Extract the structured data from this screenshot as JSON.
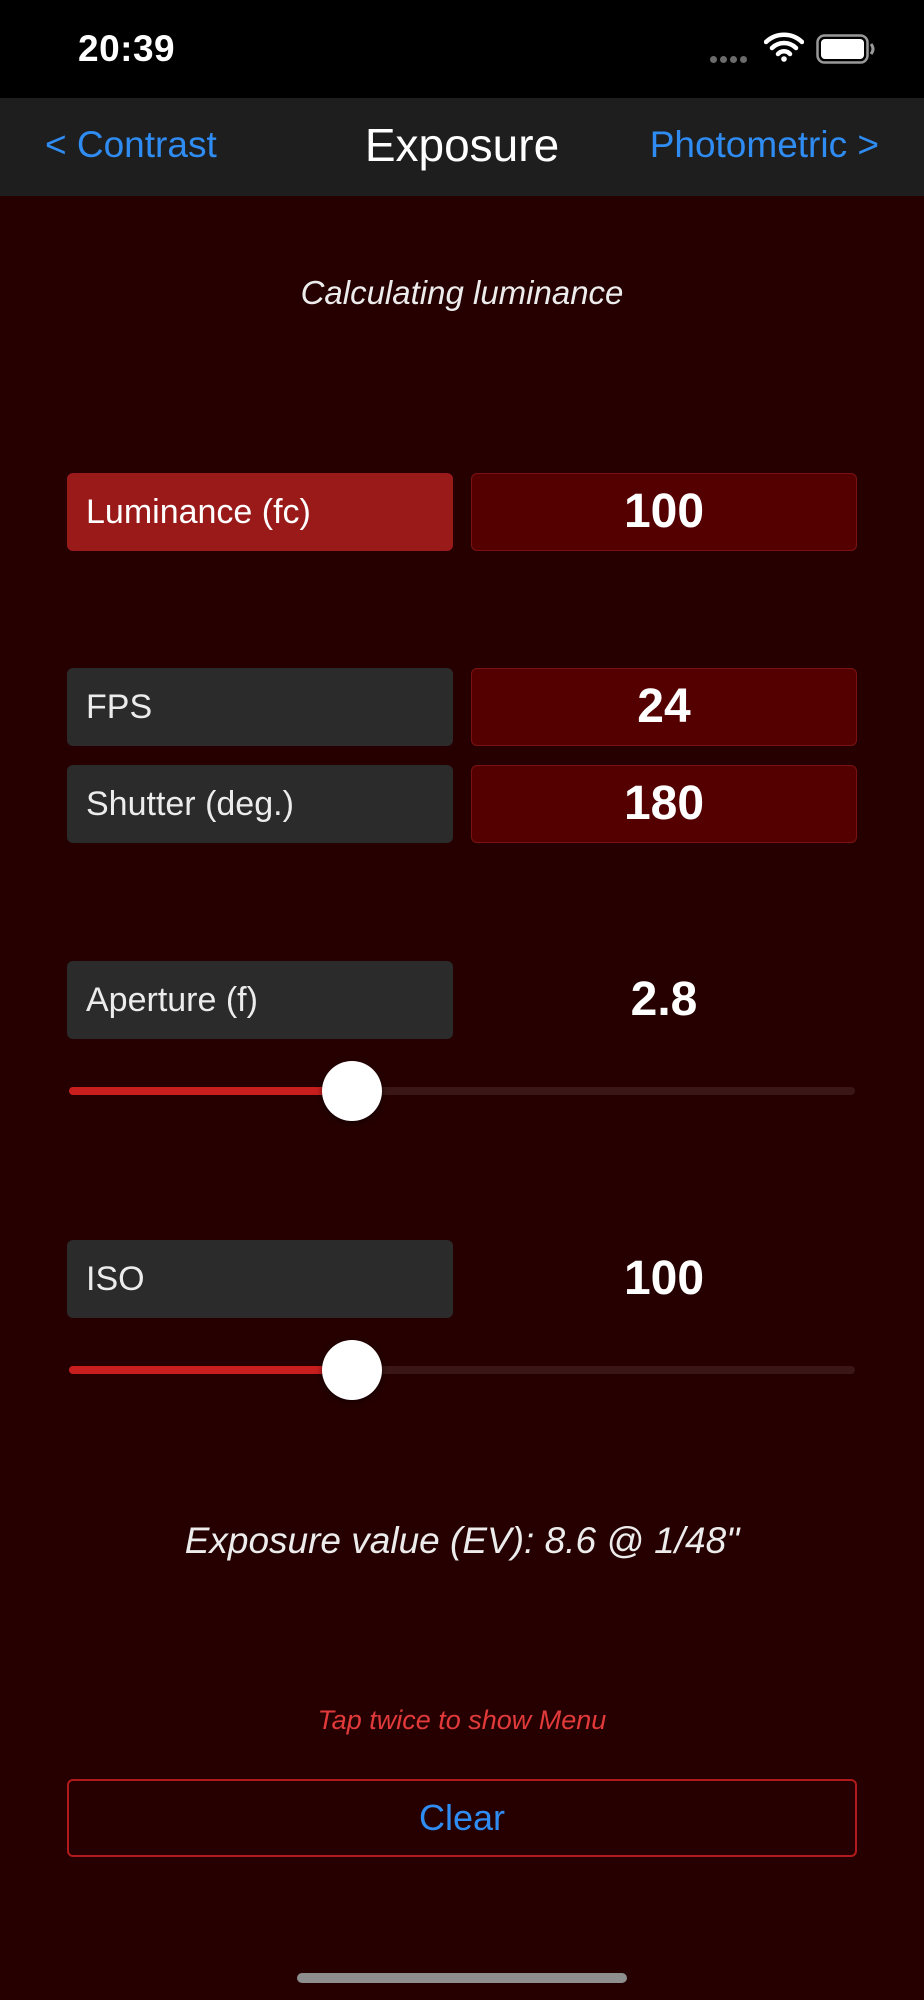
{
  "status_bar": {
    "time": "20:39",
    "icons": [
      "cellular-signal-icon",
      "wifi-icon",
      "battery-icon"
    ]
  },
  "nav": {
    "back_label": "< Contrast",
    "title": "Exposure",
    "forward_label": "Photometric >"
  },
  "subtitle": "Calculating luminance",
  "fields": {
    "luminance": {
      "label": "Luminance (fc)",
      "value": "100"
    },
    "fps": {
      "label": "FPS",
      "value": "24"
    },
    "shutter": {
      "label": "Shutter (deg.)",
      "value": "180"
    },
    "aperture": {
      "label": "Aperture (f)",
      "value": "2.8",
      "slider_fraction": 0.36
    },
    "iso": {
      "label": "ISO",
      "value": "100",
      "slider_fraction": 0.36
    }
  },
  "exposure_value_text": "Exposure value (EV): 8.6 @ 1/48\"",
  "hint": "Tap twice to show Menu",
  "clear_label": "Clear",
  "colors": {
    "background": "#260000",
    "accent_red": "#c81e1e",
    "link_blue": "#2f8cf2",
    "active_label": "#9a1a1a"
  }
}
